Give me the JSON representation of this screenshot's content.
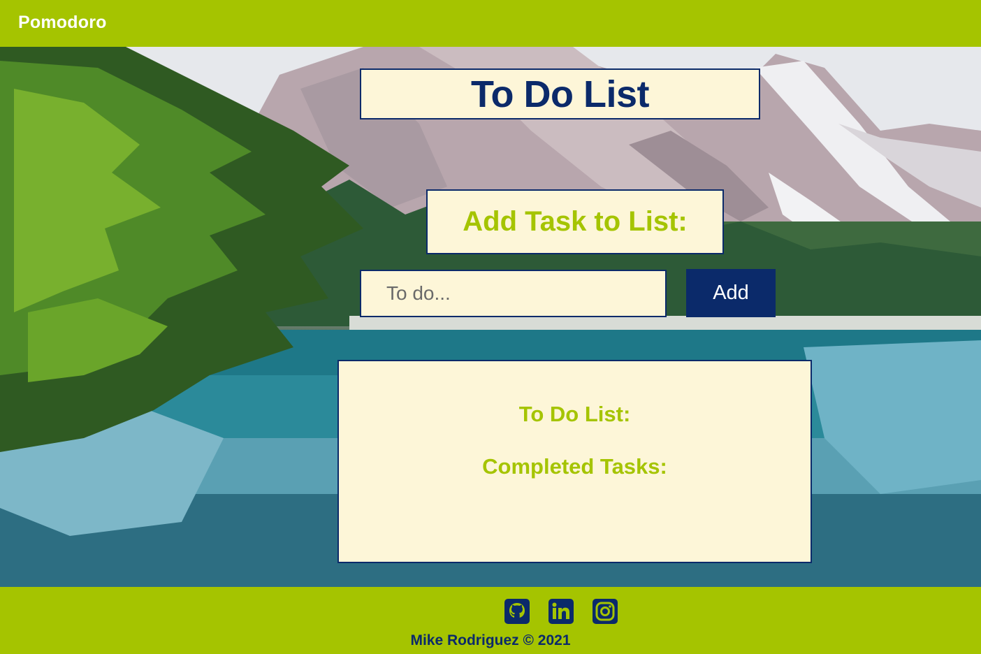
{
  "header": {
    "brand": "Pomodoro"
  },
  "main": {
    "title": "To Do List",
    "add_heading": "Add Task to List:",
    "input": {
      "placeholder": "To do...",
      "value": ""
    },
    "add_button_label": "Add",
    "list_panel": {
      "todo_heading": "To Do List:",
      "completed_heading": "Completed Tasks:"
    }
  },
  "footer": {
    "social": [
      {
        "icon": "github-icon"
      },
      {
        "icon": "linkedin-icon"
      },
      {
        "icon": "instagram-icon"
      }
    ],
    "copyright": "Mike Rodriguez © 2021"
  },
  "colors": {
    "accent_green": "#a5c400",
    "navy": "#0b2a6a",
    "cream": "#fdf6d8"
  }
}
